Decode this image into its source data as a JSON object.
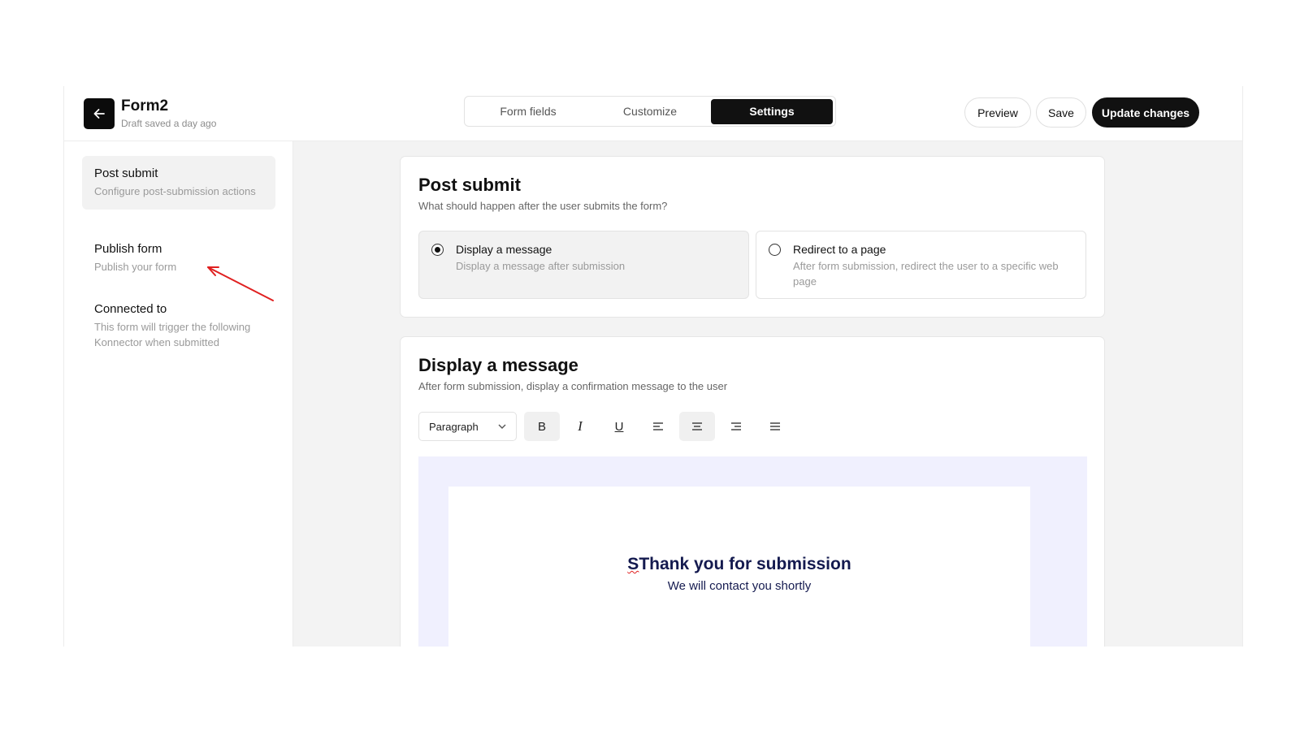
{
  "header": {
    "title": "Form2",
    "subtitle": "Draft saved a day ago",
    "tabs": [
      {
        "label": "Form fields",
        "active": false
      },
      {
        "label": "Customize",
        "active": false
      },
      {
        "label": "Settings",
        "active": true
      }
    ],
    "preview_label": "Preview",
    "save_label": "Save",
    "update_label": "Update changes"
  },
  "sidebar": {
    "items": [
      {
        "title": "Post submit",
        "desc": "Configure post-submission actions",
        "active": true
      },
      {
        "title": "Publish form",
        "desc": "Publish your form",
        "active": false
      },
      {
        "title": "Connected to",
        "desc": "This form will trigger the following Konnector when submitted",
        "active": false
      }
    ]
  },
  "post_submit": {
    "title": "Post submit",
    "desc": "What should happen after the user submits the form?",
    "options": [
      {
        "title": "Display a message",
        "desc": "Display a message after submission",
        "selected": true
      },
      {
        "title": "Redirect to a page",
        "desc": "After form submission, redirect the user to a specific web page",
        "selected": false
      }
    ]
  },
  "display_message": {
    "title": "Display a message",
    "desc": "After form submission, display a confirmation message to the user",
    "block_type": "Paragraph",
    "tools": [
      "bold-icon",
      "italic-icon",
      "underline-icon",
      "align-left-icon",
      "align-center-icon",
      "align-right-icon",
      "align-justify-icon"
    ],
    "active_tools": [
      "bold-icon",
      "align-center-icon"
    ],
    "message_prefix": "S",
    "message_title_rest": "Thank you for submission",
    "message_subtitle": "We will contact you shortly"
  },
  "colors": {
    "accent": "#111111",
    "annotation_arrow": "#e02020",
    "editor_background": "#f0f0fe",
    "message_text": "#141a4f"
  }
}
